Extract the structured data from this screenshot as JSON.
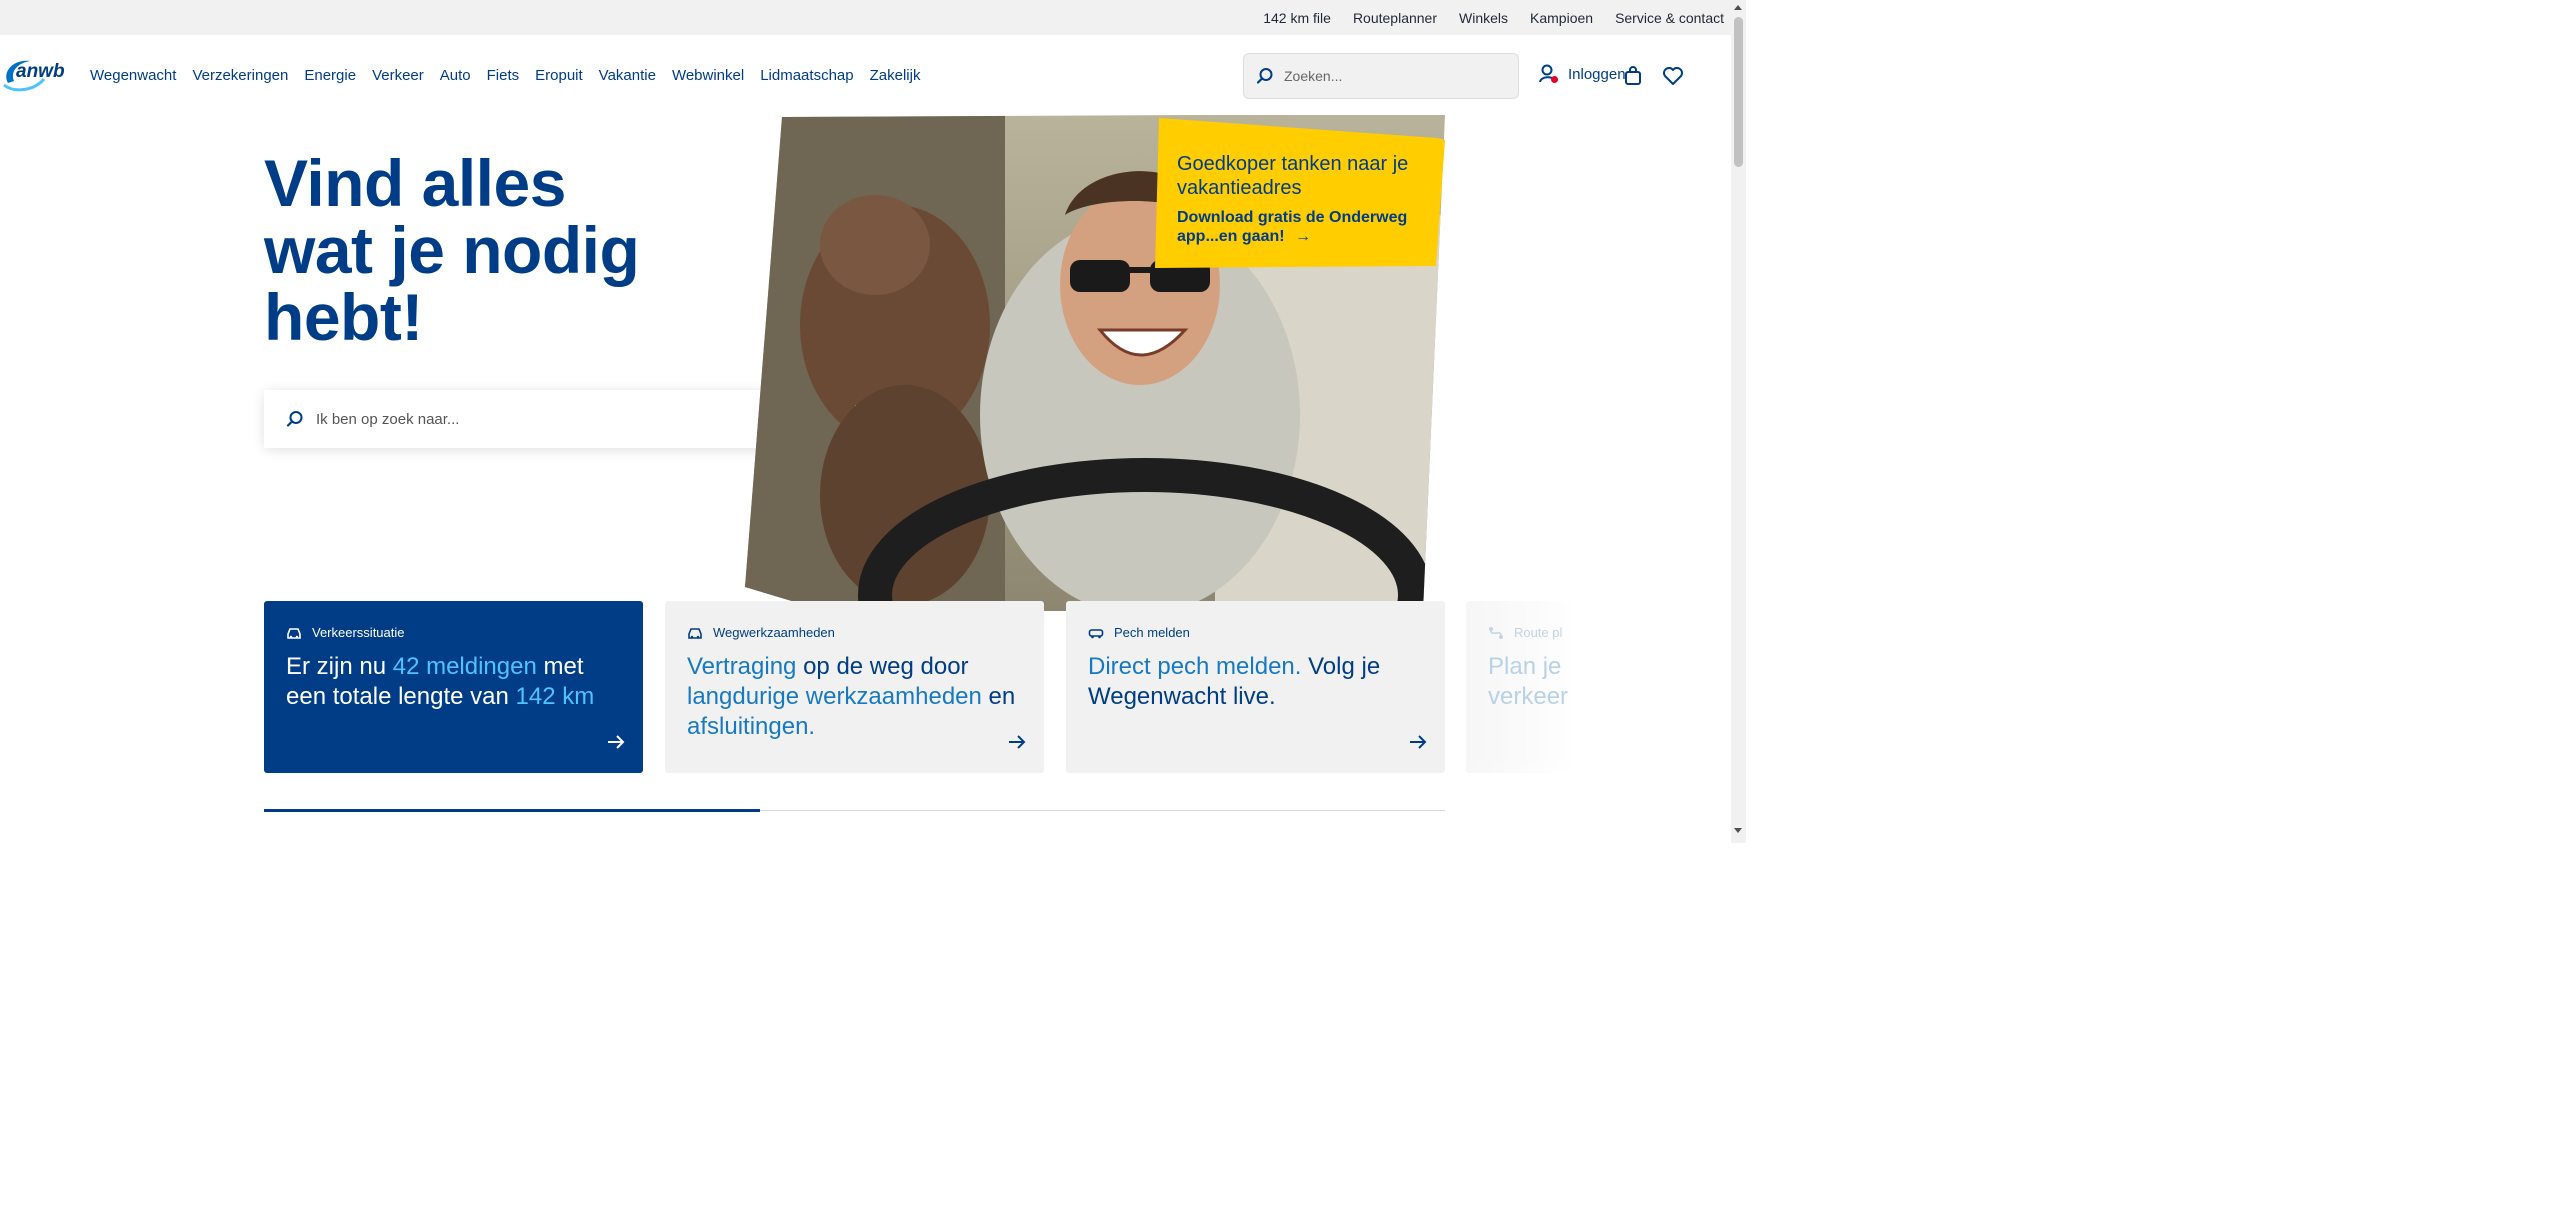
{
  "topbar": {
    "links": [
      "142 km file",
      "Routeplanner",
      "Winkels",
      "Kampioen",
      "Service & contact"
    ]
  },
  "header": {
    "logo_text": "anwb",
    "nav": [
      "Wegenwacht",
      "Verzekeringen",
      "Energie",
      "Verkeer",
      "Auto",
      "Fiets",
      "Eropuit",
      "Vakantie",
      "Webwinkel",
      "Lidmaatschap",
      "Zakelijk"
    ],
    "search_placeholder": "Zoeken...",
    "login_label": "Inloggen"
  },
  "hero": {
    "title": "Vind alles wat je nodig hebt!",
    "search_placeholder": "Ik ben op zoek naar...",
    "promo": {
      "title": "Goedkoper tanken naar je vakantieadres",
      "subtitle": "Download gratis de Onderweg app...en gaan!"
    }
  },
  "cards": [
    {
      "label": "Verkeerssituatie",
      "parts": [
        "Er zijn nu ",
        "42 meldingen",
        " met een totale lengte van ",
        "142 km"
      ]
    },
    {
      "label": "Wegwerkzaamheden",
      "parts": [
        "Vertraging",
        " op de weg door ",
        "langdurige werkzaamheden",
        " en ",
        "afsluitingen."
      ]
    },
    {
      "label": "Pech melden",
      "parts": [
        "Direct pech melden.",
        " Volg je Wegenwacht live."
      ]
    },
    {
      "label": "Route pl",
      "parts": [
        "Plan je",
        " verkeer"
      ]
    }
  ],
  "colors": {
    "brand_blue": "#003d86",
    "accent_yellow": "#ffcd00",
    "highlight_blue": "#1779c4",
    "highlight_light": "#4fc3ff"
  },
  "carousel_progress": 0.42
}
